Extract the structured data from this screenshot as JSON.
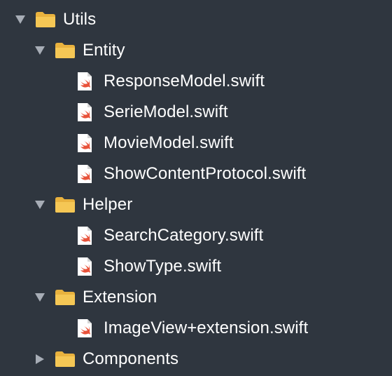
{
  "tree": {
    "utils": {
      "label": "Utils",
      "expanded": true,
      "icon": "folder-icon"
    },
    "entity": {
      "label": "Entity",
      "expanded": true,
      "icon": "folder-icon"
    },
    "entity_files": [
      {
        "label": "ResponseModel.swift",
        "icon": "swift-file-icon"
      },
      {
        "label": "SerieModel.swift",
        "icon": "swift-file-icon"
      },
      {
        "label": "MovieModel.swift",
        "icon": "swift-file-icon"
      },
      {
        "label": "ShowContentProtocol.swift",
        "icon": "swift-file-icon"
      }
    ],
    "helper": {
      "label": "Helper",
      "expanded": true,
      "icon": "folder-icon"
    },
    "helper_files": [
      {
        "label": "SearchCategory.swift",
        "icon": "swift-file-icon"
      },
      {
        "label": "ShowType.swift",
        "icon": "swift-file-icon"
      }
    ],
    "extension": {
      "label": "Extension",
      "expanded": true,
      "icon": "folder-icon"
    },
    "extension_files": [
      {
        "label": "ImageView+extension.swift",
        "icon": "swift-file-icon"
      }
    ],
    "components": {
      "label": "Components",
      "expanded": false,
      "icon": "folder-icon"
    }
  },
  "colors": {
    "background": "#2f363f",
    "text": "#ffffff",
    "folder": "#f3c04d",
    "disclosure": "#a7adb6",
    "swift": "#e8523a"
  }
}
